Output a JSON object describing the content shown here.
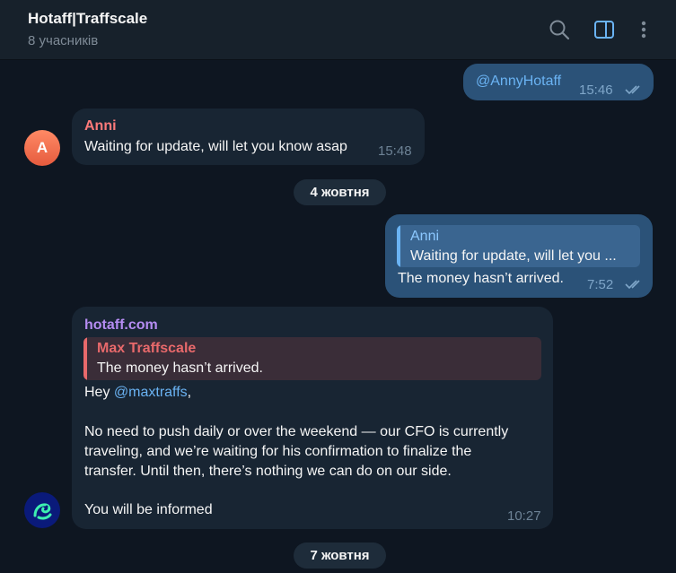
{
  "header": {
    "title": "Hotaff|Traffscale",
    "subtitle": "8 учасників",
    "icons": [
      "search-icon",
      "sidebar-toggle-icon",
      "more-vertical-icon"
    ]
  },
  "messages": {
    "m1": {
      "mention": "@AnnyHotaff",
      "time": "15:46",
      "status": "read"
    },
    "m2": {
      "sender": "Anni",
      "avatar_letter": "A",
      "text": "Waiting for update, will let you know asap",
      "time": "15:48"
    },
    "date1": "4 жовтня",
    "m3": {
      "reply_sender": "Anni",
      "reply_text": "Waiting for update, will let you ...",
      "text": "The money hasn’t arrived.",
      "time": "7:52",
      "status": "read"
    },
    "m4": {
      "sender": "hotaff.com",
      "reply_sender": "Max Traffscale",
      "reply_text": "The money hasn’t arrived.",
      "greeting": "Hey ",
      "mention": "@maxtraffs",
      "greeting_end": ",",
      "line1": "No need to push daily or over the weekend — our CFO is currently",
      "line2": "traveling, and we’re waiting for his confirmation to finalize the",
      "line3": "transfer. Until then, there’s nothing we can do on our side.",
      "line4": "You will be informed",
      "time": "10:27"
    },
    "date2": "7 жовтня"
  },
  "colors": {
    "background": "#0e1621",
    "header": "#17212b",
    "incoming_bubble": "#182533",
    "outgoing_bubble": "#2b5278",
    "accent": "#6ab3f3",
    "anni_name": "#ff7a7a",
    "hotaff_name": "#b58cf2",
    "max_name": "#e8696b"
  }
}
